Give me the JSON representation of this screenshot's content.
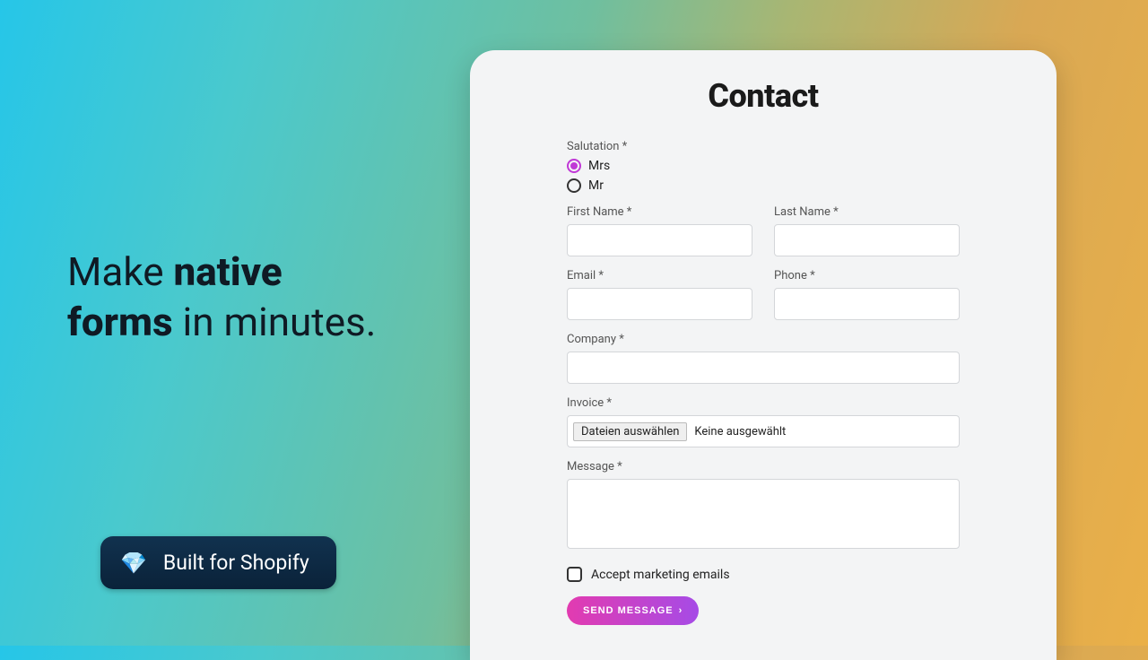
{
  "hero": {
    "line1_prefix": "Make ",
    "line1_bold": "native",
    "line2_bold": "forms",
    "line2_suffix": " in minutes."
  },
  "bfs": {
    "icon": "💎",
    "label": "Built for Shopify"
  },
  "form": {
    "title": "Contact",
    "salutation_label": "Salutation *",
    "salutation_options": {
      "mrs": "Mrs",
      "mr": "Mr"
    },
    "first_name_label": "First Name *",
    "last_name_label": "Last Name *",
    "email_label": "Email *",
    "phone_label": "Phone *",
    "company_label": "Company *",
    "invoice_label": "Invoice *",
    "file_button": "Dateien auswählen",
    "file_status": "Keine ausgewählt",
    "message_label": "Message *",
    "checkbox_label": "Accept marketing emails",
    "submit_label": "SEND MESSAGE",
    "submit_chevron": "›"
  }
}
